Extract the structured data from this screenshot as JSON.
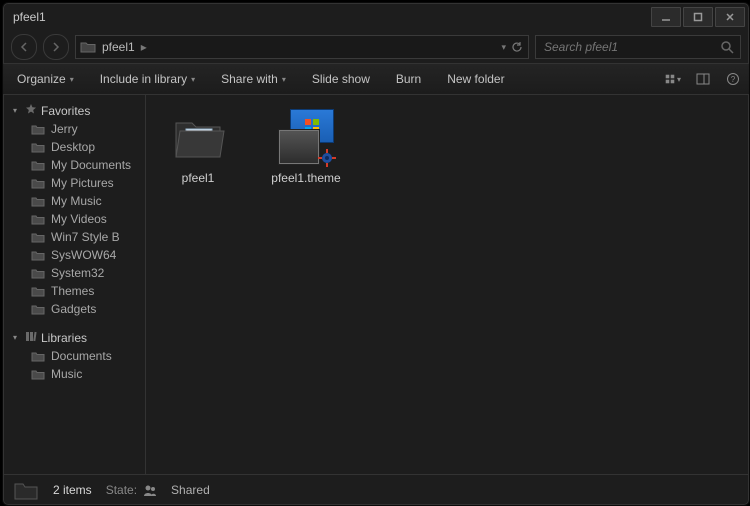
{
  "window": {
    "title": "pfeel1"
  },
  "address": {
    "path_segment": "pfeel1",
    "separator": "▸"
  },
  "search": {
    "placeholder": "Search pfeel1"
  },
  "toolbar": {
    "organize": "Organize",
    "include": "Include in library",
    "share": "Share with",
    "slideshow": "Slide show",
    "burn": "Burn",
    "newfolder": "New folder"
  },
  "sidebar": {
    "favorites_label": "Favorites",
    "favorites": [
      {
        "label": "Jerry"
      },
      {
        "label": "Desktop"
      },
      {
        "label": "My Documents"
      },
      {
        "label": "My Pictures"
      },
      {
        "label": "My Music"
      },
      {
        "label": "My Videos"
      },
      {
        "label": "Win7 Style B"
      },
      {
        "label": "SysWOW64"
      },
      {
        "label": "System32"
      },
      {
        "label": "Themes"
      },
      {
        "label": "Gadgets"
      }
    ],
    "libraries_label": "Libraries",
    "libraries": [
      {
        "label": "Documents"
      },
      {
        "label": "Music"
      }
    ]
  },
  "content": {
    "items": [
      {
        "name": "pfeel1",
        "kind": "folder"
      },
      {
        "name": "pfeel1.theme",
        "kind": "theme"
      }
    ]
  },
  "statusbar": {
    "count": "2 items",
    "state_label": "State:",
    "state_value": "Shared"
  }
}
